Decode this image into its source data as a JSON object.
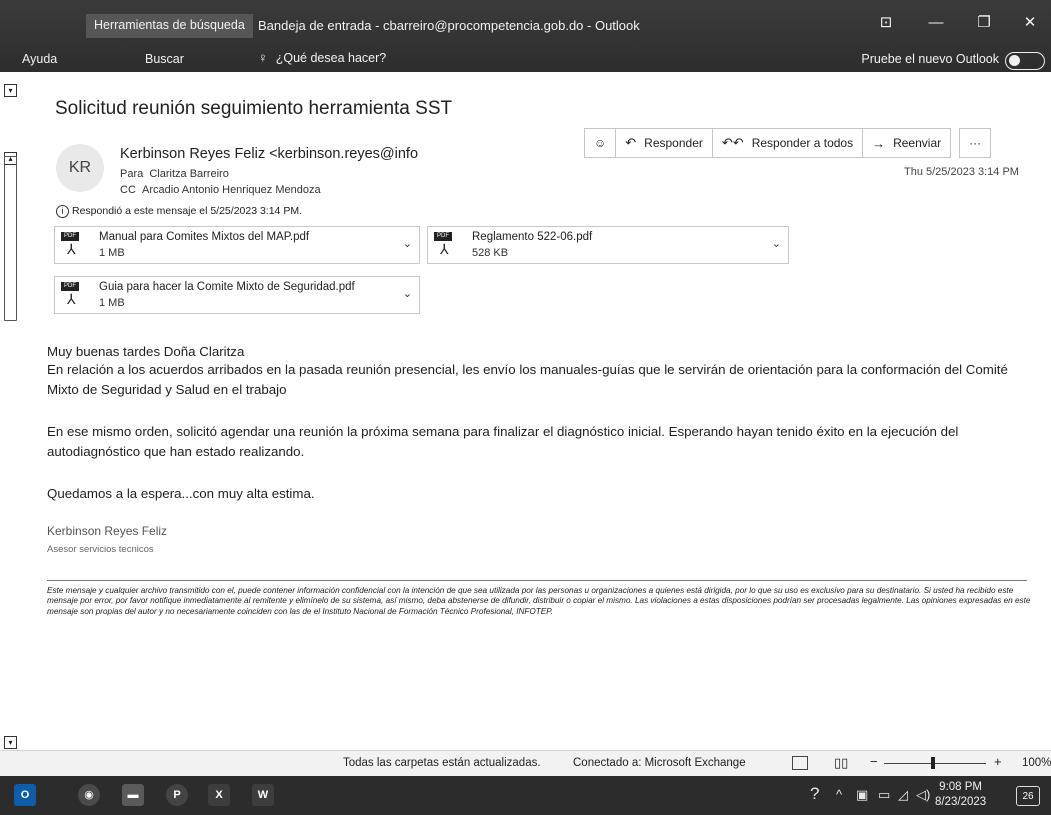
{
  "titlebar": {
    "search_tools_tab": "Herramientas de búsqueda",
    "window_title": "Bandeja de entrada - cbarreiro@procompetencia.gob.do - Outlook",
    "help_tab": "Ayuda",
    "search_tab": "Buscar",
    "tell_me": "¿Qué desea hacer?",
    "try_new_outlook": "Pruebe el nuevo Outlook"
  },
  "message": {
    "subject": "Solicitud reunión seguimiento herramienta SST",
    "avatar_initials": "KR",
    "sender": "Kerbinson Reyes Feliz <kerbinson.reyes@info",
    "to_label": "Para",
    "to_value": "Claritza Barreiro",
    "cc_label": "CC",
    "cc_value": "Arcadio Antonio Henriquez Mendoza",
    "replied_notice": "Respondió a este mensaje el 5/25/2023 3:14 PM.",
    "timestamp": "Thu 5/25/2023 3:14 PM"
  },
  "actions": {
    "reply": "Responder",
    "reply_all": "Responder a todos",
    "forward": "Reenviar",
    "more": "···"
  },
  "attachments": [
    {
      "name": "Manual para Comites Mixtos del MAP.pdf",
      "size": "1 MB"
    },
    {
      "name": "Reglamento 522-06.pdf",
      "size": "528 KB"
    },
    {
      "name": "Guia para hacer la Comite Mixto de Seguridad.pdf",
      "size": "1 MB"
    }
  ],
  "body": {
    "greeting": "Muy buenas tardes Doña Claritza",
    "paragraph1": "En relación a los acuerdos arribados en la pasada reunión presencial, les envío los manuales-guías que le servirán de orientación para la conformación del Comité Mixto de Seguridad y Salud en el trabajo",
    "paragraph2": "En ese mismo orden, solicitó agendar una reunión la próxima semana para finalizar el diagnóstico inicial. Esperando hayan tenido éxito en la ejecución del autodiagnóstico que han estado realizando.",
    "closing": "Quedamos a la espera...con muy alta estima.",
    "signature_name": "Kerbinson Reyes Feliz",
    "signature_title": "Asesor servicios tecnicos",
    "disclaimer": "Este mensaje y cualquier archivo transmitido con el, puede contener información confidencial con la intención de que sea utilizada por las personas u organizaciones a quienes está dirigida, por lo que su uso es exclusivo para su destinatario. Si usted ha recibido este mensaje por error, por favor notifique inmediatamente al remitente y elimínelo de su sistema, así mismo, deba abstenerse de difundir, distribuir o copiar el mismo. Las violaciones a estas disposiciones podrían ser procesadas legalmente. Las opiniones expresadas en este mensaje son propias del autor y no necesariamente coinciden con las de el Instituto Nacional de Formación Técnico Profesional, INFOTEP."
  },
  "statusbar": {
    "folders_status": "Todas las carpetas están actualizadas.",
    "connection": "Conectado a: Microsoft Exchange",
    "zoom_minus": "−",
    "zoom_plus": "+",
    "zoom_level": "100%"
  },
  "taskbar": {
    "time": "9:08 PM",
    "date": "8/23/2023",
    "notifications": "26",
    "apps": [
      "outlook-icon",
      "chrome-icon",
      "file-explorer-icon",
      "powerpoint-icon",
      "excel-icon",
      "word-icon"
    ]
  }
}
